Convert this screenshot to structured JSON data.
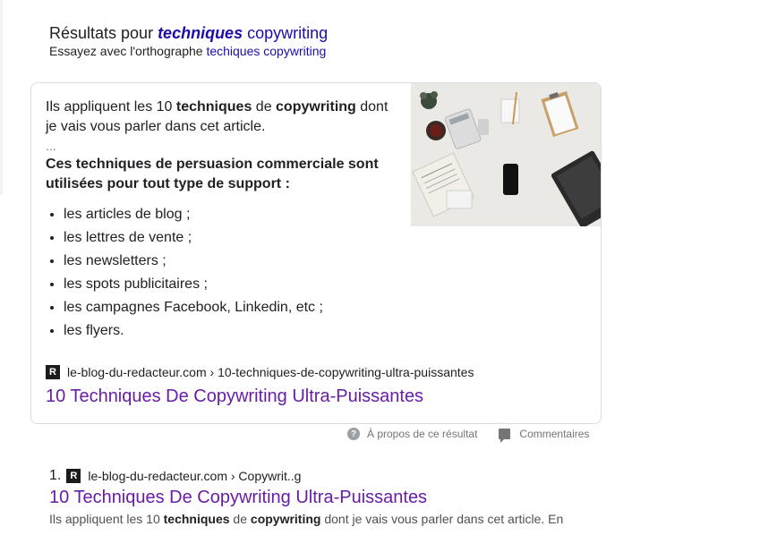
{
  "spell": {
    "prefix": "Résultats pour ",
    "query_bold": "techniques",
    "query_rest": "copywriting",
    "try_prefix": "Essayez avec l'orthographe ",
    "try_link": "techiques copywriting"
  },
  "featured": {
    "snippet": {
      "p1_a": "Ils appliquent les 10 ",
      "p1_b": "techniques",
      "p1_c": " de ",
      "p1_d": "copywriting",
      "p1_e": " dont je vais vous parler dans cet article.",
      "ellipsis": "...",
      "bold_heading": "Ces techniques de persuasion commerciale sont utilisées pour tout type de support :"
    },
    "list": [
      "les articles de blog ;",
      "les lettres de vente ;",
      "les newsletters ;",
      "les spots publicitaires ;",
      "les campagnes Facebook, Linkedin, etc ;",
      "les flyers."
    ],
    "favicon_letter": "R",
    "cite": "le-blog-du-redacteur.com › 10-techniques-de-copywriting-ultra-puissantes",
    "title": "10 Techniques De Copywriting Ultra-Puissantes"
  },
  "about": {
    "about_label": "À propos de ce résultat",
    "feedback_label": "Commentaires"
  },
  "result": {
    "number": "1.",
    "favicon_letter": "R",
    "cite": "le-blog-du-redacteur.com › Copywrit..g",
    "title": "10 Techniques De Copywriting Ultra-Puissantes",
    "snippet_a": "Ils appliquent les 10 ",
    "snippet_b": "techniques",
    "snippet_c": " de ",
    "snippet_d": "copywriting",
    "snippet_e": " dont je vais vous parler dans cet article. En"
  },
  "colors": {
    "link_blue": "#1a0dab",
    "visited_purple": "#681da8",
    "text": "#202124",
    "muted": "#70757a"
  }
}
